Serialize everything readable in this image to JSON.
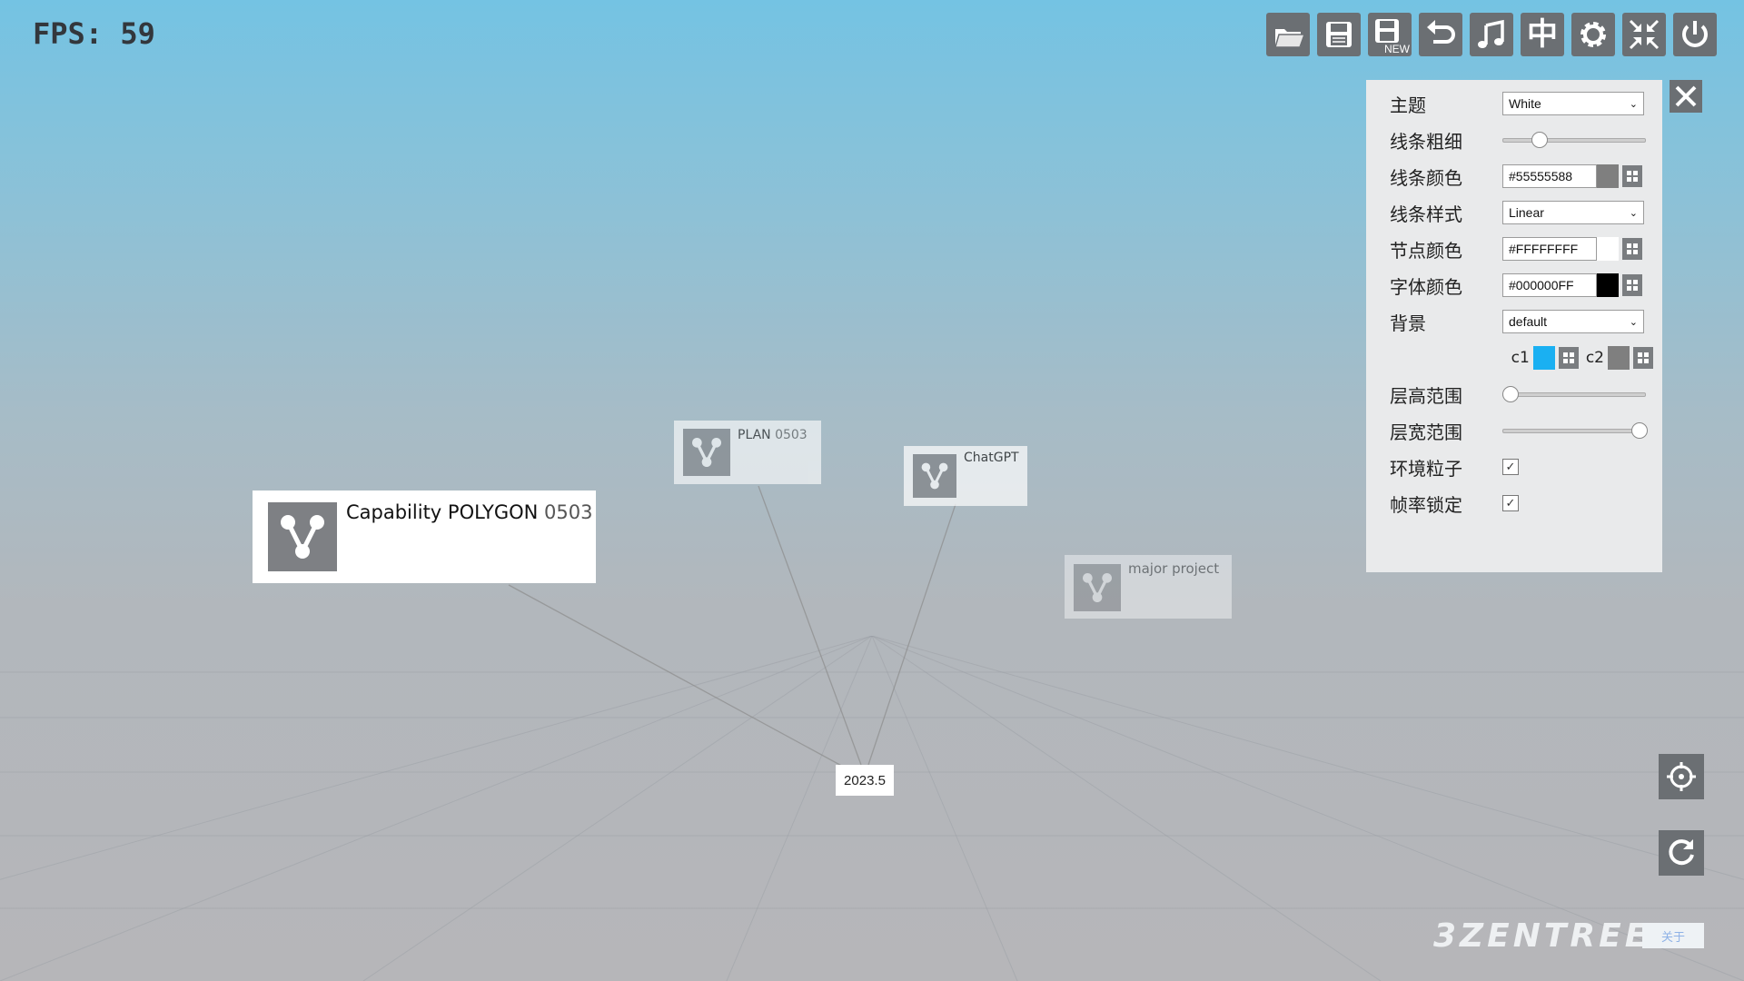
{
  "fps": {
    "label": "FPS: 59"
  },
  "toolbar": {
    "buttons": [
      {
        "icon": "open-folder-icon"
      },
      {
        "icon": "save-icon"
      },
      {
        "icon": "save-new-icon",
        "text": "NEW"
      },
      {
        "icon": "undo-icon"
      },
      {
        "icon": "music-icon"
      },
      {
        "icon": "language-icon",
        "text": "中"
      },
      {
        "icon": "gear-icon"
      },
      {
        "icon": "collapse-icon"
      },
      {
        "icon": "power-icon"
      }
    ]
  },
  "graph": {
    "nodes": [
      {
        "name": "Capability POLYGON",
        "suffix": "0503"
      },
      {
        "name": "PLAN",
        "suffix": "0503"
      },
      {
        "name": "ChatGPT",
        "suffix": ""
      },
      {
        "name": "major project",
        "suffix": ""
      }
    ],
    "root": {
      "label": "2023.5"
    }
  },
  "settings": {
    "theme": {
      "label": "主题",
      "value": "White"
    },
    "line_width": {
      "label": "线条粗细",
      "level": 0.25
    },
    "line_color": {
      "label": "线条颜色",
      "value": "#55555588",
      "swatch": "#7f7f7f"
    },
    "line_style": {
      "label": "线条样式",
      "value": "Linear"
    },
    "node_color": {
      "label": "节点颜色",
      "value": "#FFFFFFFF",
      "swatch": "#ffffff"
    },
    "font_color": {
      "label": "字体颜色",
      "value": "#000000FF",
      "swatch": "#000000"
    },
    "background": {
      "label": "背景",
      "value": "default",
      "c1_label": "c1",
      "c2_label": "c2",
      "c1_color": "#1ab0f2",
      "c2_color": "#7f7f7f"
    },
    "layer_height": {
      "label": "层高范围",
      "level": 0.05
    },
    "layer_width": {
      "label": "层宽范围",
      "level": 0.95
    },
    "ambient_particles": {
      "label": "环境粒子",
      "checked": true
    },
    "frame_lock": {
      "label": "帧率锁定",
      "checked": true
    }
  },
  "footer": {
    "logo": "3ZENTREE",
    "about": "关于"
  },
  "colors": {
    "button_bg": "#6b6f73",
    "panel_bg": "#e9eaeb",
    "accent": "#1ab0f2"
  }
}
